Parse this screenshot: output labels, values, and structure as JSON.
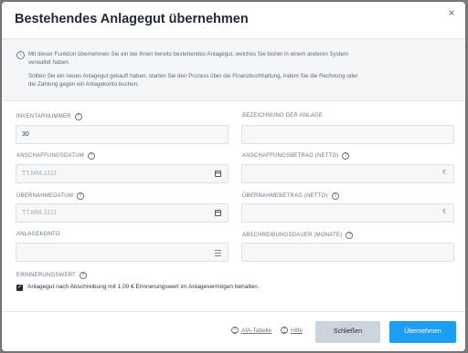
{
  "modal": {
    "title": "Bestehendes Anlagegut übernehmen",
    "close_icon": "×"
  },
  "info": {
    "icon": "i",
    "paragraph1": "Mit dieser Funktion übernehmen Sie ein bei Ihnen bereits bestehendes Anlagegut, welches Sie bisher in einem anderen System verwaltet haben.",
    "paragraph2": "Sollten Sie ein neues Anlagegut gekauft haben, starten Sie den Prozess über die Finanzbuchhaltung, indem Sie die Rechnung oder die Zahlung gegen ein Anlagekonto buchen."
  },
  "form": {
    "inventarnummer": {
      "label": "INVENTARNUMMER",
      "value": "30"
    },
    "bezeichnung": {
      "label": "BEZEICHNUNG DER ANLAGE",
      "value": ""
    },
    "anschaffungsdatum": {
      "label": "ANSCHAFFUNGSDATUM",
      "placeholder": "TT.MM.JJJJ"
    },
    "anschaffungsbetrag": {
      "label": "ANSCHAFFUNGSBETRAG (NETTO)",
      "suffix": "€"
    },
    "uebernahmedatum": {
      "label": "ÜBERNAHMEDATUM",
      "placeholder": "TT.MM.JJJJ"
    },
    "uebernahmebetrag": {
      "label": "ÜBERNAHMEBETRAG (NETTO)",
      "suffix": "€"
    },
    "anlagekonto": {
      "label": "ANLAGEKONTO",
      "value": ""
    },
    "abschreibungsdauer": {
      "label": "ABSCHREIBUNGSDAUER (MONATE)",
      "value": ""
    },
    "erinnerungswert": {
      "label": "ERINNERUNGSWERT",
      "checkbox_label": "Anlagegut nach Abschreibung mit 1,00 € Erinnerungswert im Anlagevermögen behalten.",
      "checked": true
    }
  },
  "footer": {
    "afa_link": "AfA-Tabelle",
    "hilfe_link": "Hilfe",
    "close_button": "Schließen",
    "submit_button": "Übernehmen"
  },
  "colors": {
    "primary": "#1e9ef2",
    "secondary": "#cbd3dc",
    "title": "#1f2a36"
  }
}
